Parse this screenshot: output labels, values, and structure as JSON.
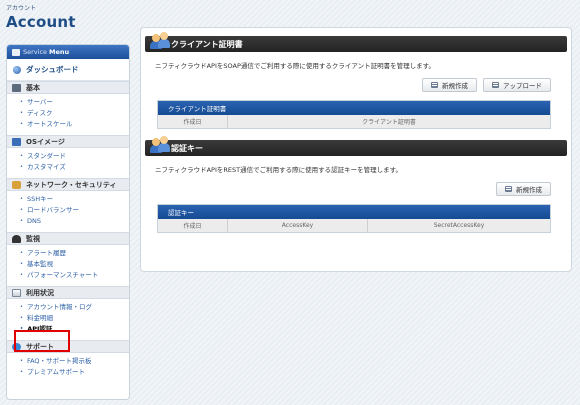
{
  "header": {
    "small_label": "アカウント",
    "title": "Account"
  },
  "sidebar": {
    "menu_label": "Service",
    "menu_label_bold": "Menu",
    "dashboard": "ダッシュボード",
    "sections": [
      {
        "title": "基本",
        "icon": "server-icon",
        "items": [
          "サーバー",
          "ディスク",
          "オートスケール"
        ]
      },
      {
        "title": "OSイメージ",
        "icon": "os-image-icon",
        "items": [
          "スタンダード",
          "カスタマイズ"
        ]
      },
      {
        "title": "ネットワーク・セキュリティ",
        "icon": "network-security-icon",
        "items": [
          "SSHキー",
          "ロードバランサー",
          "DNS"
        ]
      },
      {
        "title": "監視",
        "icon": "monitoring-icon",
        "items": [
          "アラート履歴",
          "基本監視",
          "パフォーマンスチャート"
        ]
      },
      {
        "title": "利用状況",
        "icon": "usage-icon",
        "items": [
          "アカウント情報・ログ",
          "料金明細",
          "API認証"
        ]
      },
      {
        "title": "サポート",
        "icon": "support-icon",
        "items": [
          "FAQ・サポート掲示板",
          "プレミアムサポート"
        ]
      }
    ],
    "active_item": "API認証"
  },
  "client_cert": {
    "title": "クライアント証明書",
    "description": "ニフティクラウドAPIをSOAP通信でご利用する際に使用するクライアント証明書を管理します。",
    "new_button": "新規作成",
    "upload_button": "アップロード",
    "table_title": "クライアント証明書",
    "columns": [
      "作成日",
      "クライアント証明書"
    ]
  },
  "auth_key": {
    "title": "認証キー",
    "description": "ニフティクラウドAPIをREST通信でご利用する際に使用する認証キーを管理します。",
    "new_button": "新規作成",
    "table_title": "認証キー",
    "columns": [
      "作成日",
      "AccessKey",
      "SecretAccessKey"
    ]
  },
  "colors": {
    "accent": "#1f4e86",
    "link": "#2f62a8",
    "highlight": "#e00000",
    "card_bar": "#2c2c2c"
  }
}
